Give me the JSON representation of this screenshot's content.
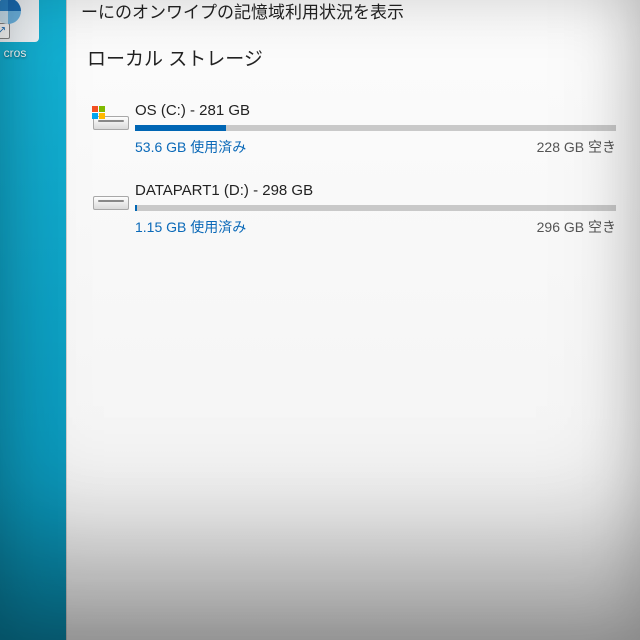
{
  "desktop": {
    "icon_label": "cros",
    "shortcut_glyph": "↗"
  },
  "header_fragment": "ーにのオンワイプの記憶域利用状況を表示",
  "section_title": "ローカル ストレージ",
  "drives": [
    {
      "title": "OS (C:) - 281 GB",
      "used_text": "53.6 GB 使用済み",
      "free_text": "228 GB 空き",
      "fill_percent": 19
    },
    {
      "title": "DATAPART1 (D:) - 298 GB",
      "used_text": "1.15 GB 使用済み",
      "free_text": "296 GB 空き",
      "fill_percent": 0.4
    }
  ]
}
